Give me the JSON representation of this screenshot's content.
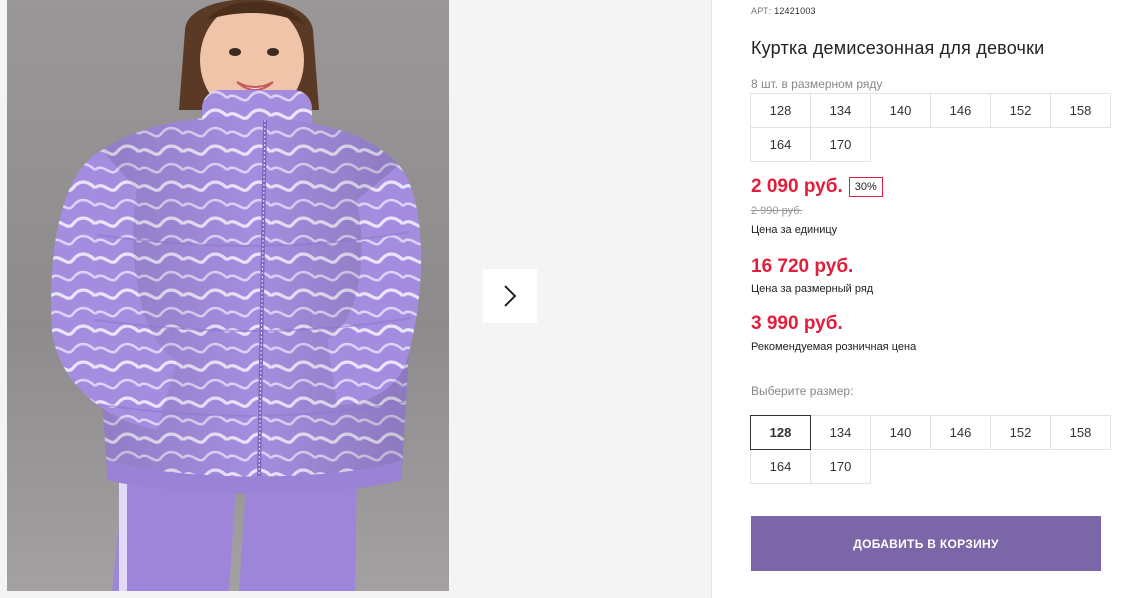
{
  "gallery": {
    "photo_alt": "",
    "next_icon": "chevron-right-icon"
  },
  "product": {
    "sku_label": "АРТ:",
    "sku_value": "12421003",
    "title": "Куртка демисезонная для девочки",
    "pack_note": "8 шт. в размерном ряду",
    "pack_sizes": [
      "128",
      "134",
      "140",
      "146",
      "152",
      "158",
      "164",
      "170"
    ],
    "price": "2 090 руб.",
    "discount": "30%",
    "old_price": "2 990 руб.",
    "unit_price_label": "Цена за единицу",
    "pack_price": "16 720 руб.",
    "pack_price_label": "Цена за размерный ряд",
    "retail_price": "3 990 руб.",
    "retail_price_label": "Рекомендуемая розничная цена",
    "choose_size_label": "Выберите размер:",
    "sizes": [
      "128",
      "134",
      "140",
      "146",
      "152",
      "158",
      "164",
      "170"
    ],
    "selected_size": "128",
    "add_to_cart_label": "ДОБАВИТЬ В КОРЗИНУ"
  },
  "colors": {
    "accent_price": "#e31e3a",
    "button": "#7b66a8",
    "jacket": "#a58fe0"
  }
}
